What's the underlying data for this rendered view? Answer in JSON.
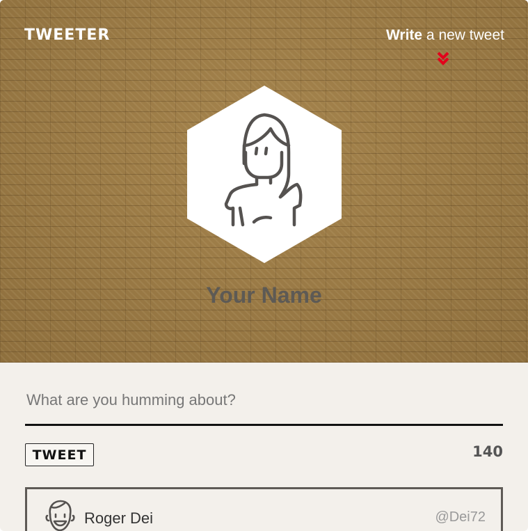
{
  "header": {
    "brand": "TWEETER",
    "write_bold": "Write",
    "write_rest": " a new tweet",
    "chevron_color": "#e3001b"
  },
  "profile": {
    "name": "Your Name",
    "avatar_icon": "woman-avatar-icon"
  },
  "compose": {
    "placeholder": "What are you humming about?",
    "value": ""
  },
  "actions": {
    "tweet_label": "TWEET",
    "char_count": "140"
  },
  "feed": [
    {
      "name": "Roger Dei",
      "handle": "@Dei72",
      "avatar_icon": "man-avatar-icon"
    }
  ],
  "colors": {
    "background": "#f3f0eb",
    "brick": "#9a7a45",
    "text_dark": "#5d5a55",
    "accent": "#e3001b"
  }
}
